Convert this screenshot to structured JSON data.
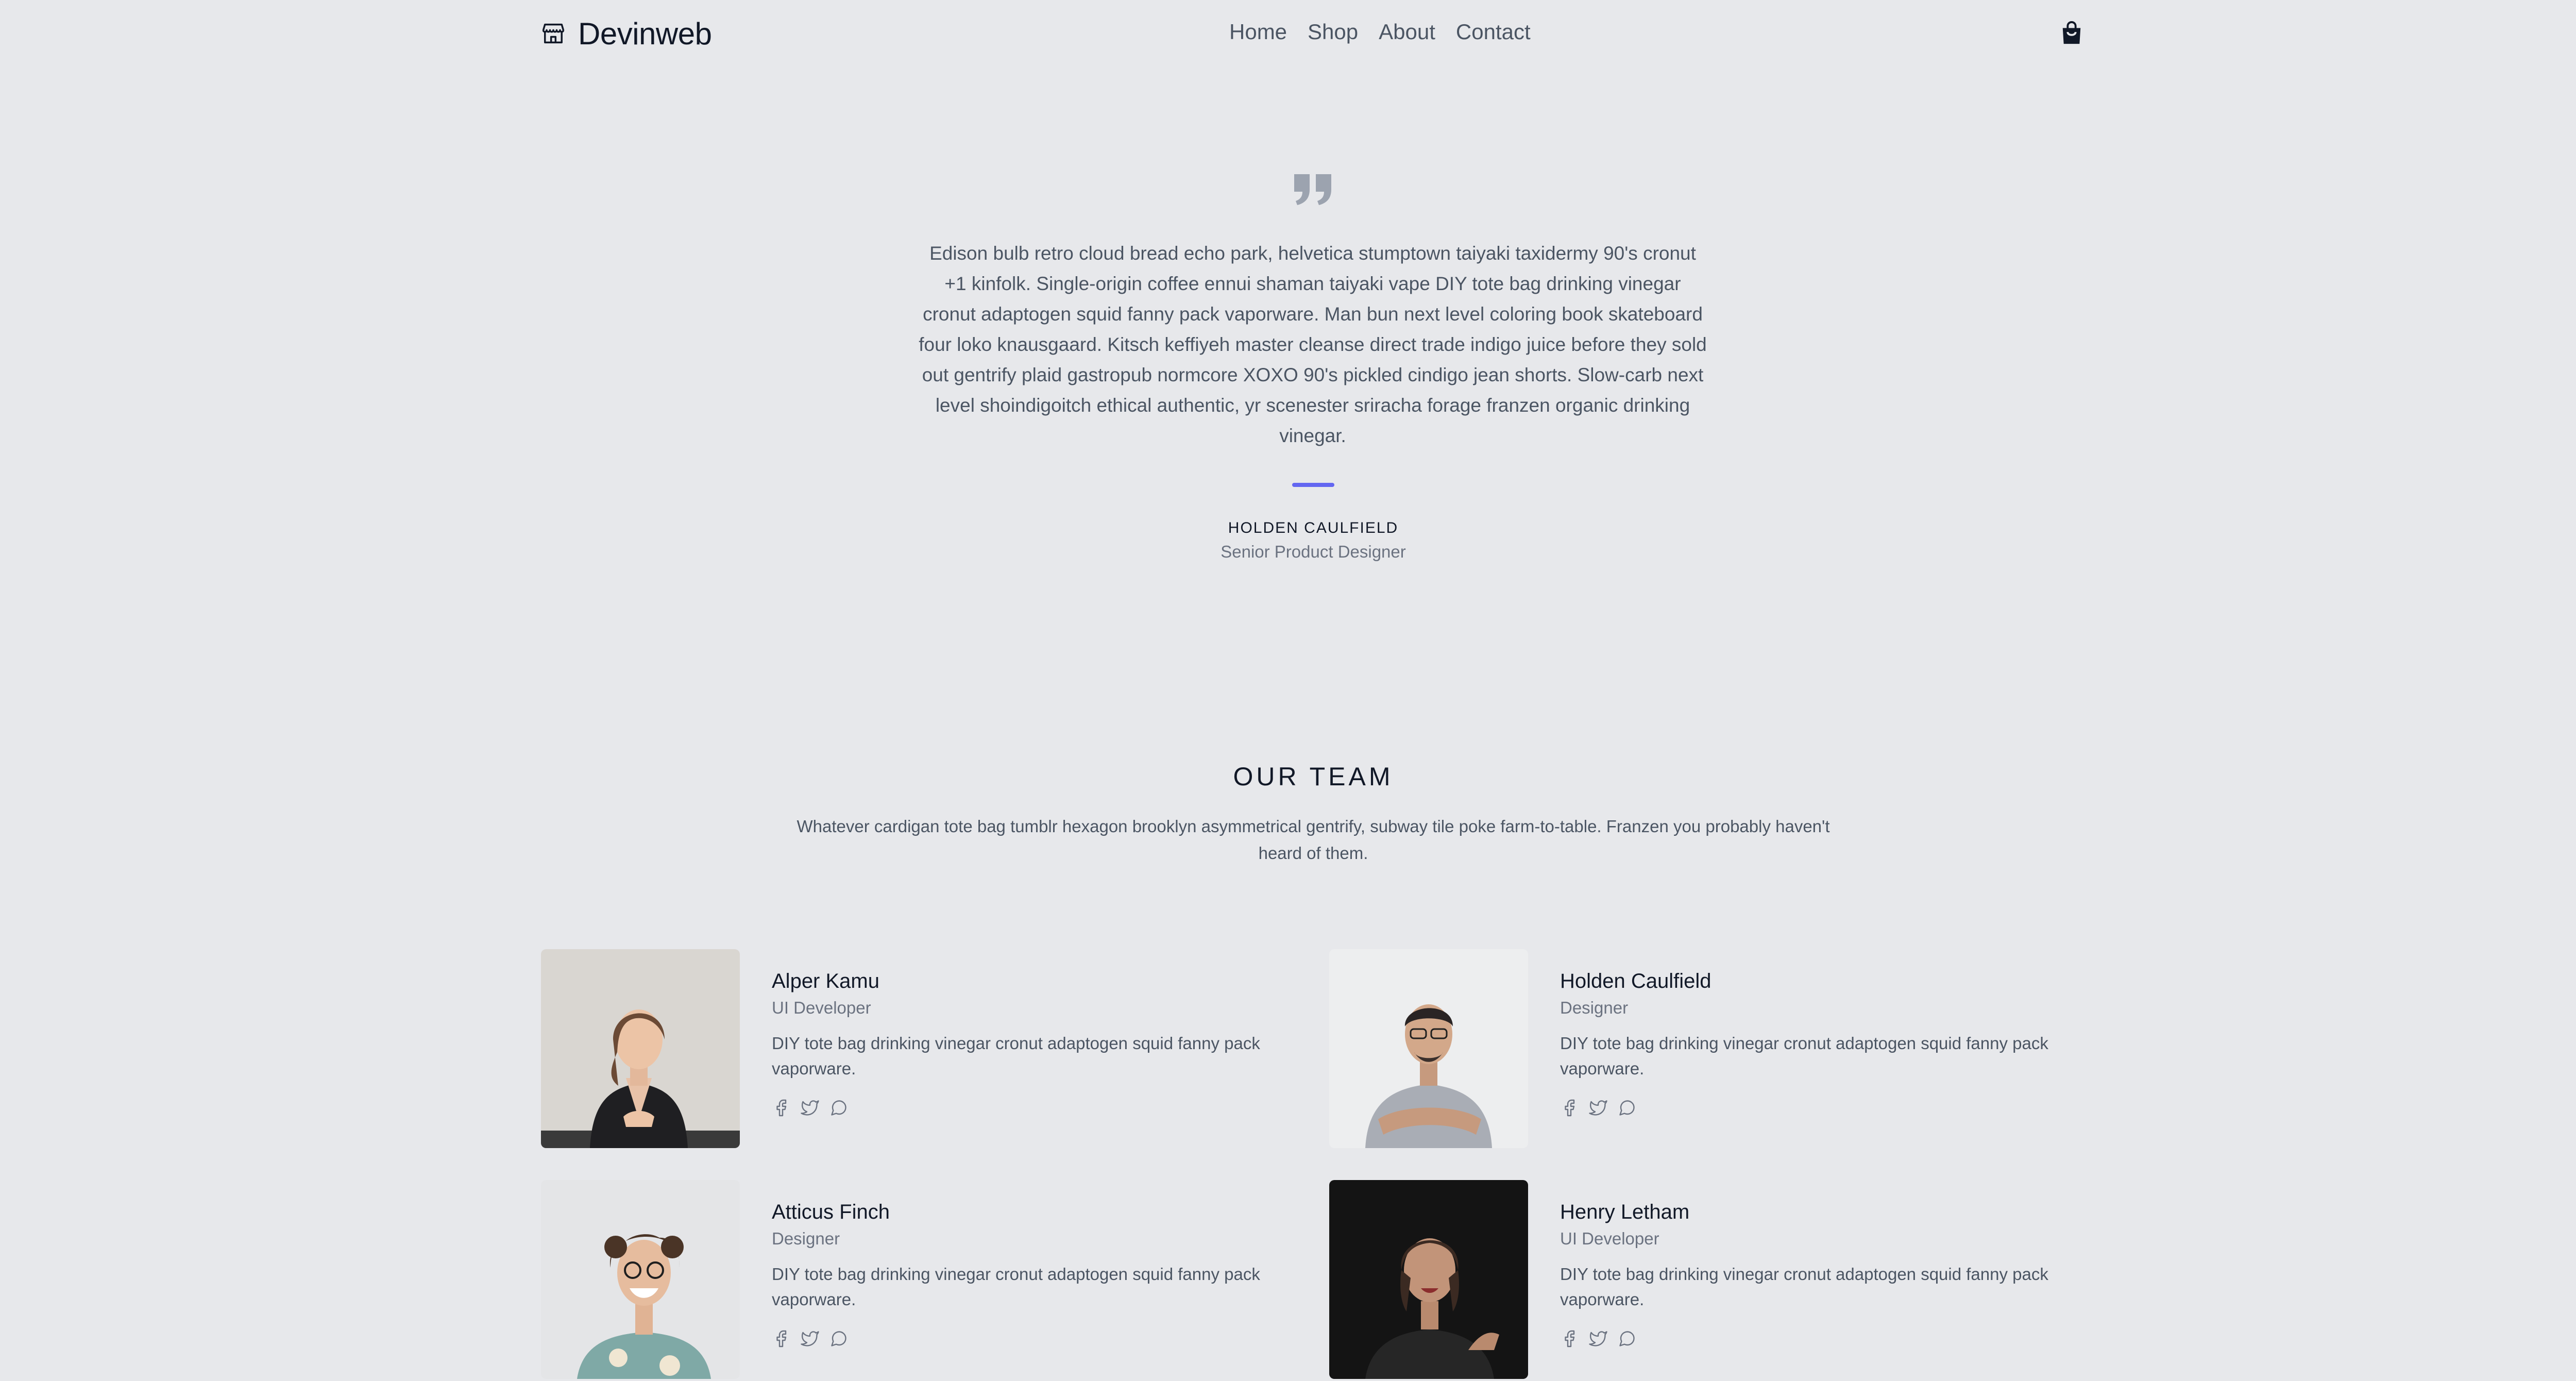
{
  "header": {
    "brand": "Devinweb",
    "nav": [
      "Home",
      "Shop",
      "About",
      "Contact"
    ]
  },
  "testimonial": {
    "text": "Edison bulb retro cloud bread echo park, helvetica stumptown taiyaki taxidermy 90's cronut +1 kinfolk. Single-origin coffee ennui shaman taiyaki vape DIY tote bag drinking vinegar cronut adaptogen squid fanny pack vaporware. Man bun next level coloring book skateboard four loko knausgaard. Kitsch keffiyeh master cleanse direct trade indigo juice before they sold out gentrify plaid gastropub normcore XOXO 90's pickled cindigo jean shorts. Slow-carb next level shoindigoitch ethical authentic, yr scenester sriracha forage franzen organic drinking vinegar.",
    "name": "HOLDEN CAULFIELD",
    "role": "Senior Product Designer"
  },
  "team": {
    "title": "OUR TEAM",
    "subtitle": "Whatever cardigan tote bag tumblr hexagon brooklyn asymmetrical gentrify, subway tile poke farm-to-table. Franzen you probably haven't heard of them.",
    "members": [
      {
        "name": "Alper Kamu",
        "role": "UI Developer",
        "bio": "DIY tote bag drinking vinegar cronut adaptogen squid fanny pack vaporware."
      },
      {
        "name": "Holden Caulfield",
        "role": "Designer",
        "bio": "DIY tote bag drinking vinegar cronut adaptogen squid fanny pack vaporware."
      },
      {
        "name": "Atticus Finch",
        "role": "Designer",
        "bio": "DIY tote bag drinking vinegar cronut adaptogen squid fanny pack vaporware."
      },
      {
        "name": "Henry Letham",
        "role": "UI Developer",
        "bio": "DIY tote bag drinking vinegar cronut adaptogen squid fanny pack vaporware."
      }
    ]
  },
  "colors": {
    "background": "#e7e8eb",
    "accent": "#6366f1",
    "heading": "#111827",
    "text": "#4b5563"
  },
  "icons": [
    "storefront-icon",
    "shopping-bag-icon",
    "quote-icon",
    "facebook-icon",
    "twitter-icon",
    "chat-icon"
  ]
}
